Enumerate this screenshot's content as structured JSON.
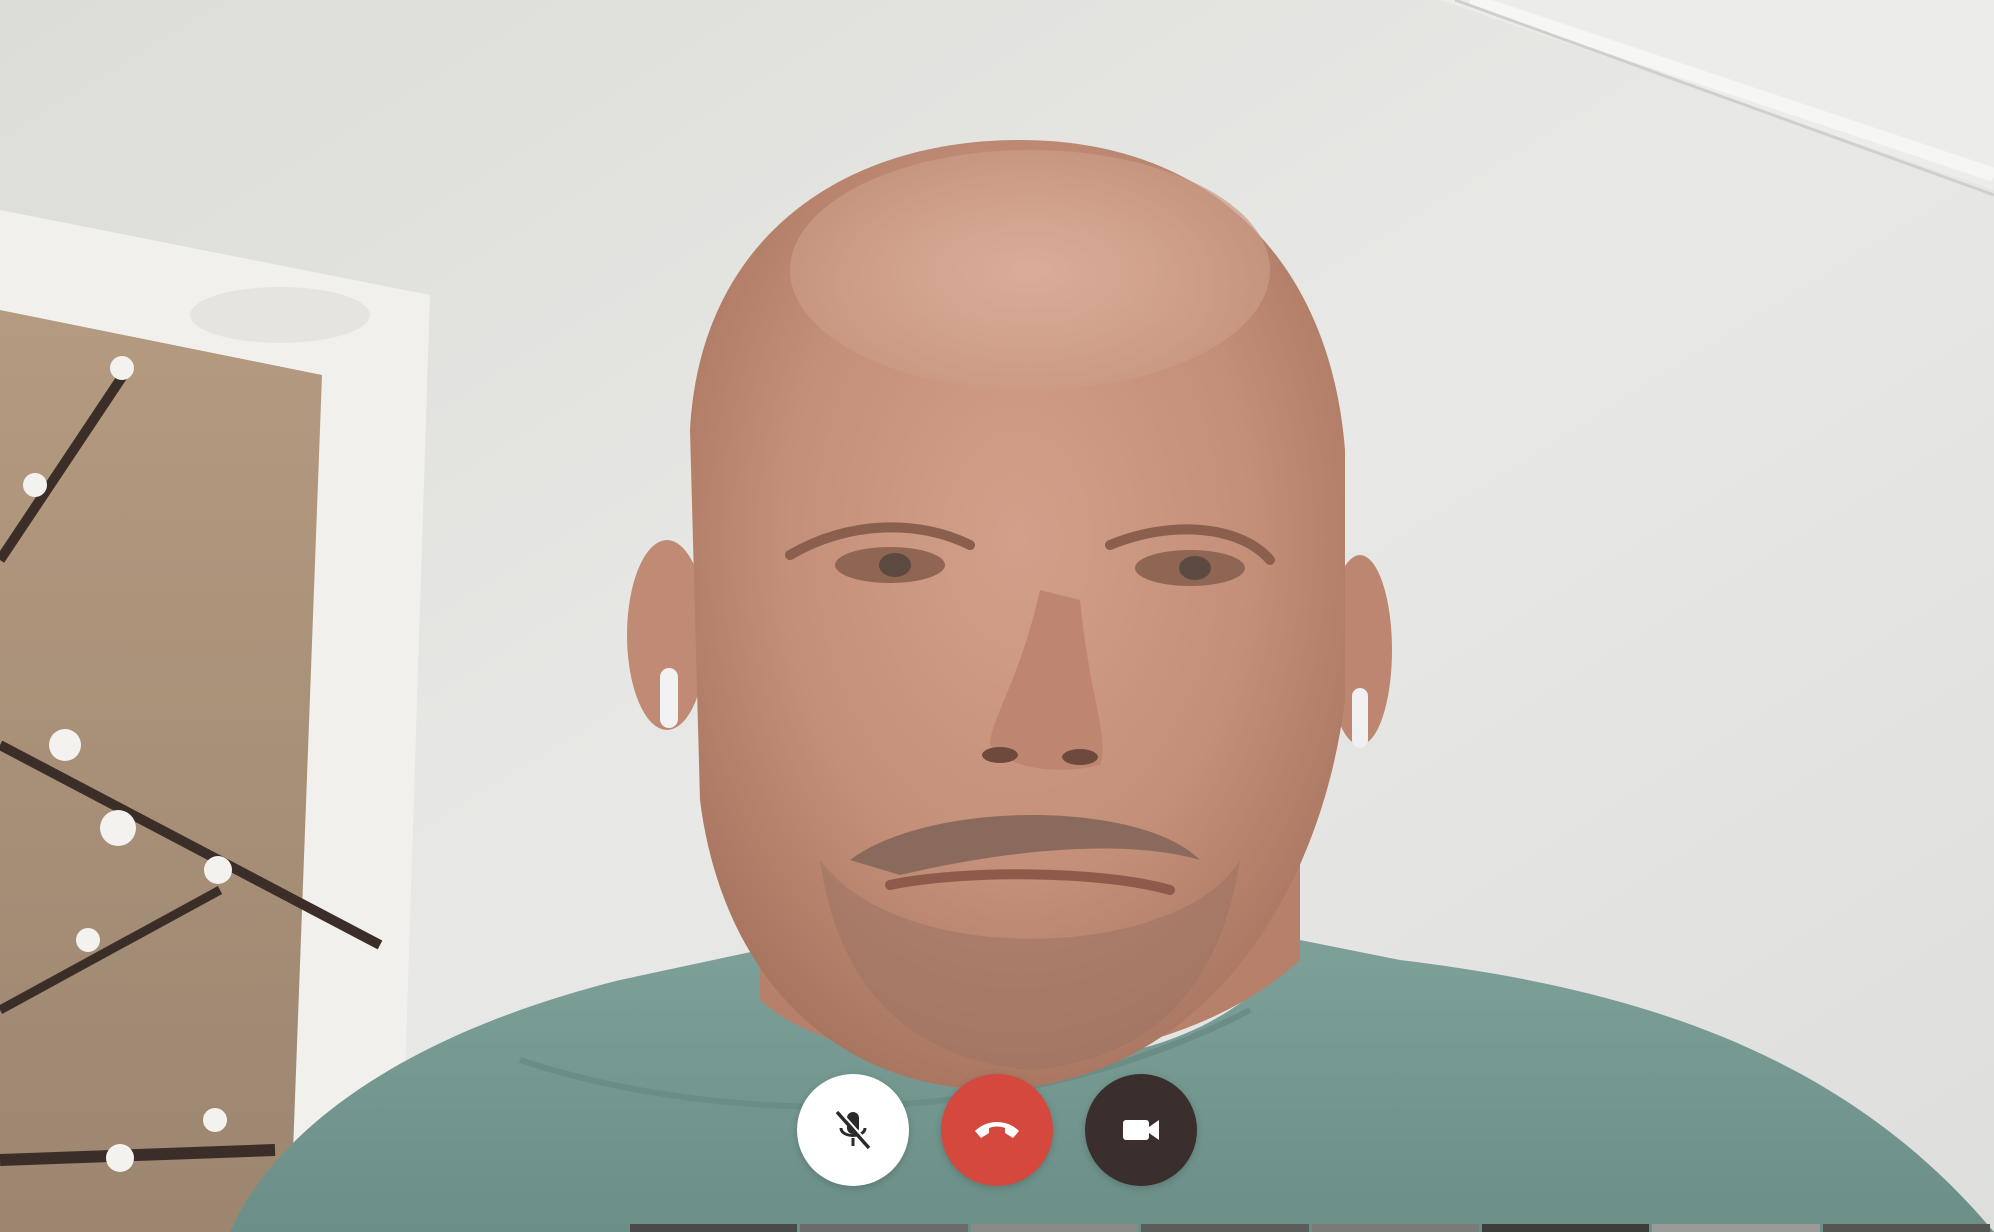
{
  "call": {
    "video_label": "",
    "controls": {
      "mute": {
        "icon": "mic-off-icon",
        "state": "muted",
        "color": "#ffffff"
      },
      "end_call": {
        "icon": "phone-hangup-icon",
        "color": "#d4483e"
      },
      "camera": {
        "icon": "video-camera-icon",
        "state": "on",
        "color": "#3a2f2c"
      }
    },
    "participant_thumbnails": [
      {
        "icon": "participant-thumbnail",
        "color": "#4a4a4a"
      },
      {
        "icon": "participant-thumbnail",
        "color": "#6b6b6b"
      },
      {
        "icon": "participant-thumbnail",
        "color": "#8a8a88"
      },
      {
        "icon": "participant-thumbnail",
        "color": "#5c5c5a"
      },
      {
        "icon": "participant-thumbnail",
        "color": "#7a7a78"
      },
      {
        "icon": "participant-thumbnail",
        "color": "#3c3c3a"
      },
      {
        "icon": "participant-thumbnail",
        "color": "#9a9a98"
      },
      {
        "icon": "participant-thumbnail",
        "color": "#555553"
      }
    ]
  }
}
